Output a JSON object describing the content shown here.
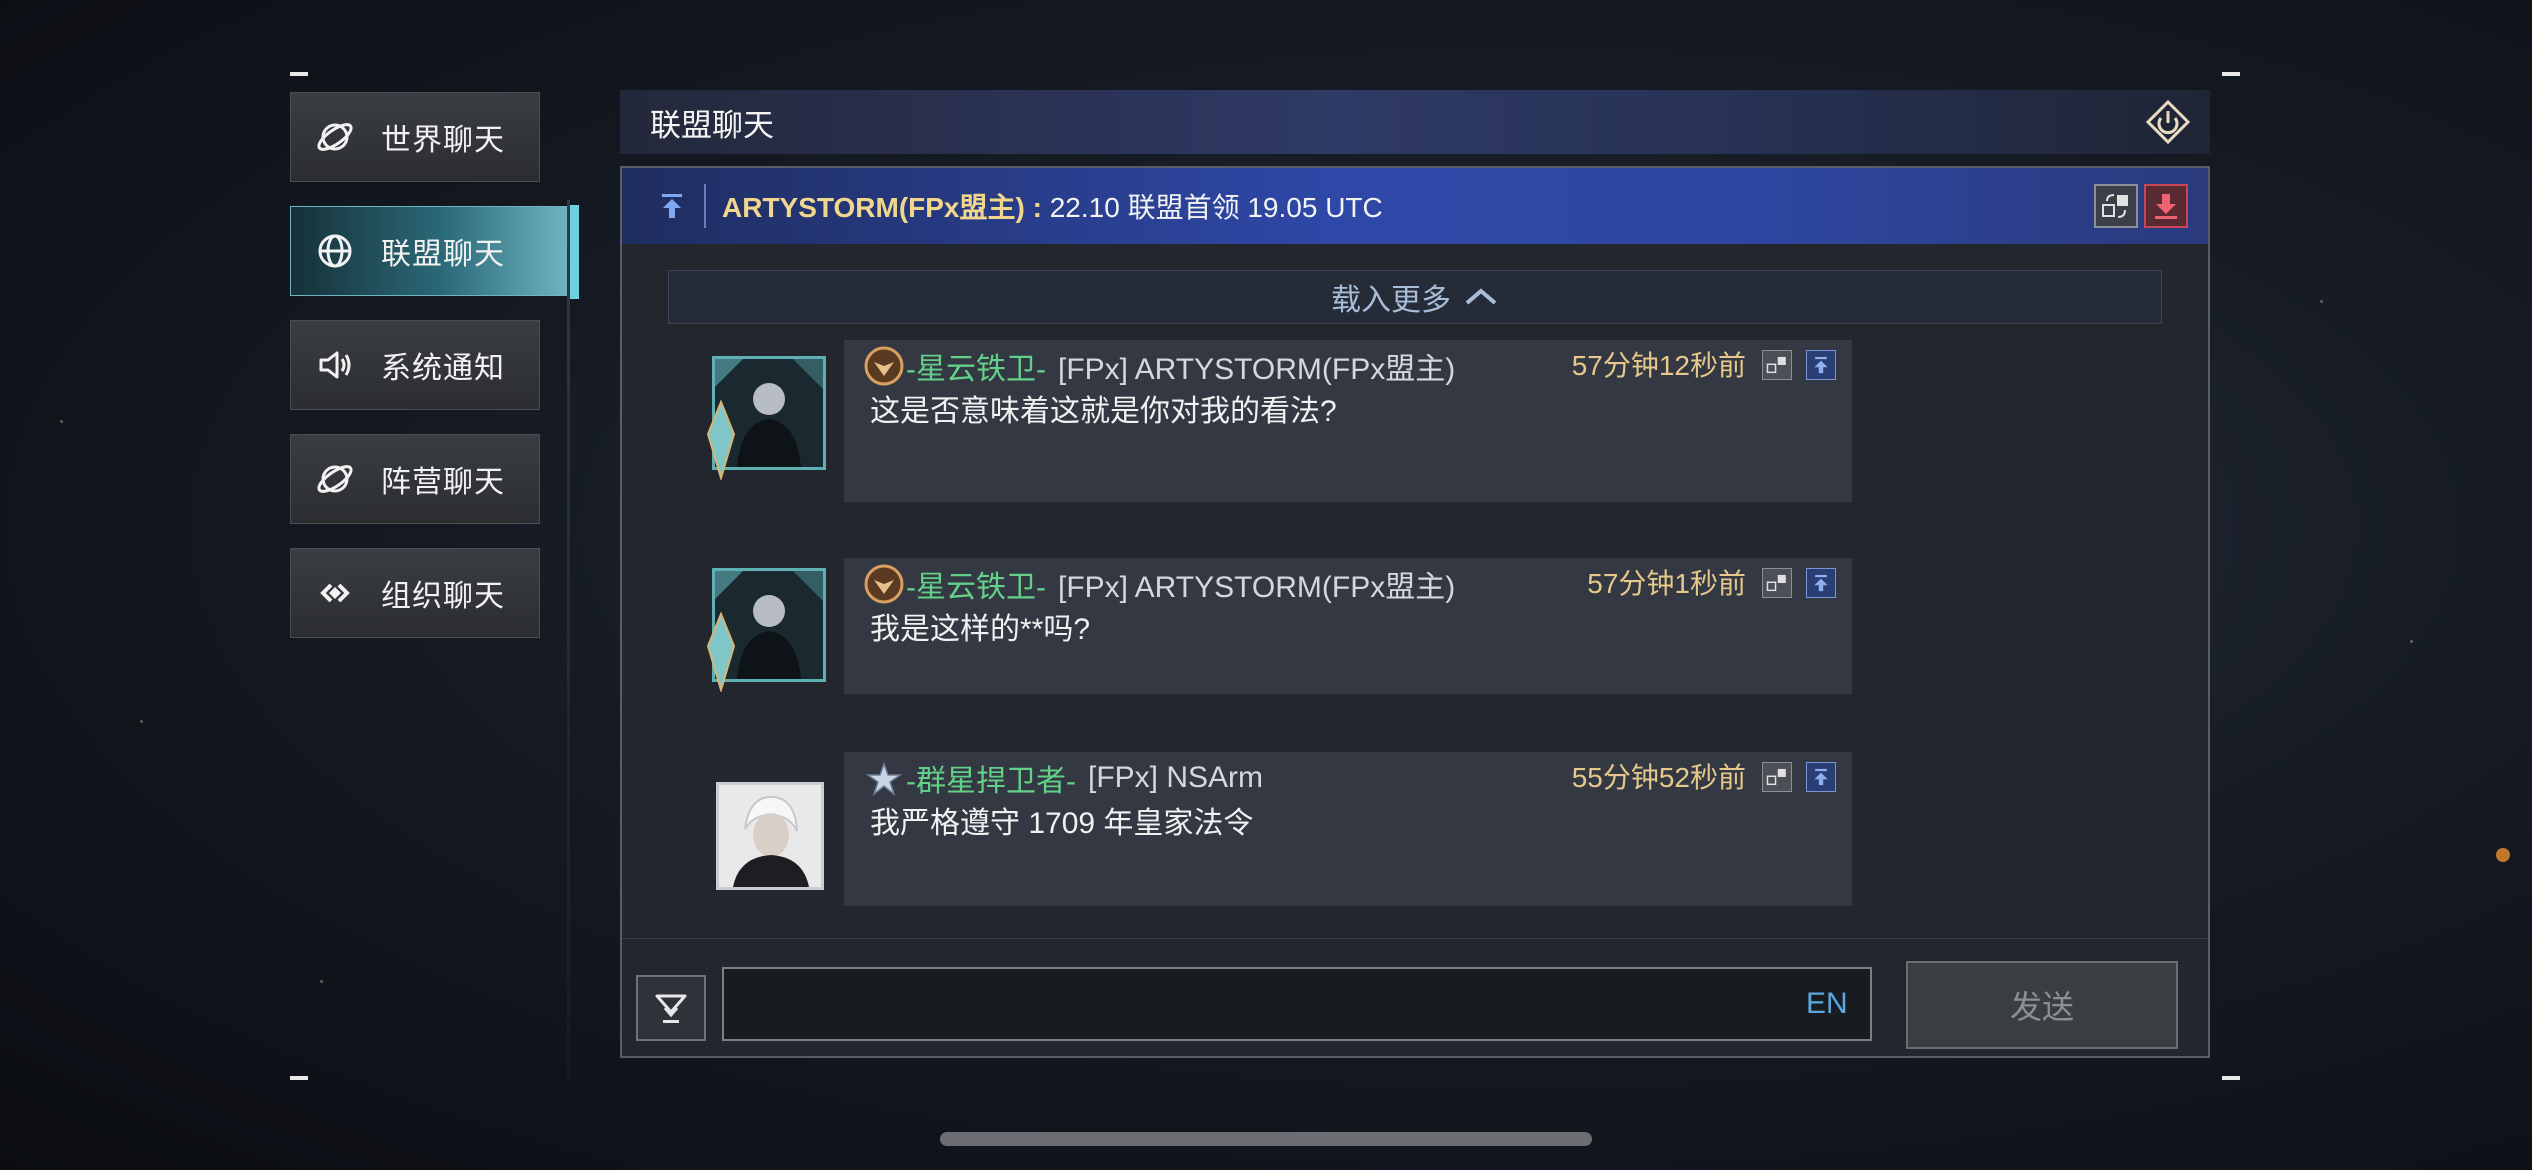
{
  "sidebar": {
    "items": [
      {
        "label": "世界聊天",
        "icon": "planet-icon",
        "active": false
      },
      {
        "label": "联盟聊天",
        "icon": "globe-icon",
        "active": true
      },
      {
        "label": "系统通知",
        "icon": "speaker-icon",
        "active": false
      },
      {
        "label": "阵营聊天",
        "icon": "planet-icon",
        "active": false
      },
      {
        "label": "组织聊天",
        "icon": "link-icon",
        "active": false
      }
    ]
  },
  "header": {
    "title": "联盟聊天",
    "close_icon": "power-icon"
  },
  "pinned": {
    "highlight": "ARTYSTORM(FPx盟主) :",
    "text": " 22.10 联盟首领 19.05 UTC"
  },
  "load_more": {
    "label": "载入更多"
  },
  "messages": [
    {
      "title": "-星云铁卫-",
      "tag_name": "[FPx] ARTYSTORM(FPx盟主)",
      "time": "57分钟12秒前",
      "body": "这是否意味着这就是你对我的看法?"
    },
    {
      "title": "-星云铁卫-",
      "tag_name": "[FPx] ARTYSTORM(FPx盟主)",
      "time": "57分钟1秒前",
      "body": "我是这样的**吗?"
    },
    {
      "title": "-群星捍卫者-",
      "tag_name": "[FPx] NSArm",
      "time": "55分钟52秒前",
      "body": "我严格遵守 1709 年皇家法令"
    }
  ],
  "input": {
    "value": "",
    "placeholder": "",
    "lang": "EN"
  },
  "send": {
    "label": "发送"
  },
  "colors": {
    "accent_cyan": "#6cd0e0",
    "title_green": "#63d08a",
    "time_gold": "#e6c98a",
    "pinned_gold": "#f1d78c",
    "lang_blue": "#5aa8e0"
  }
}
